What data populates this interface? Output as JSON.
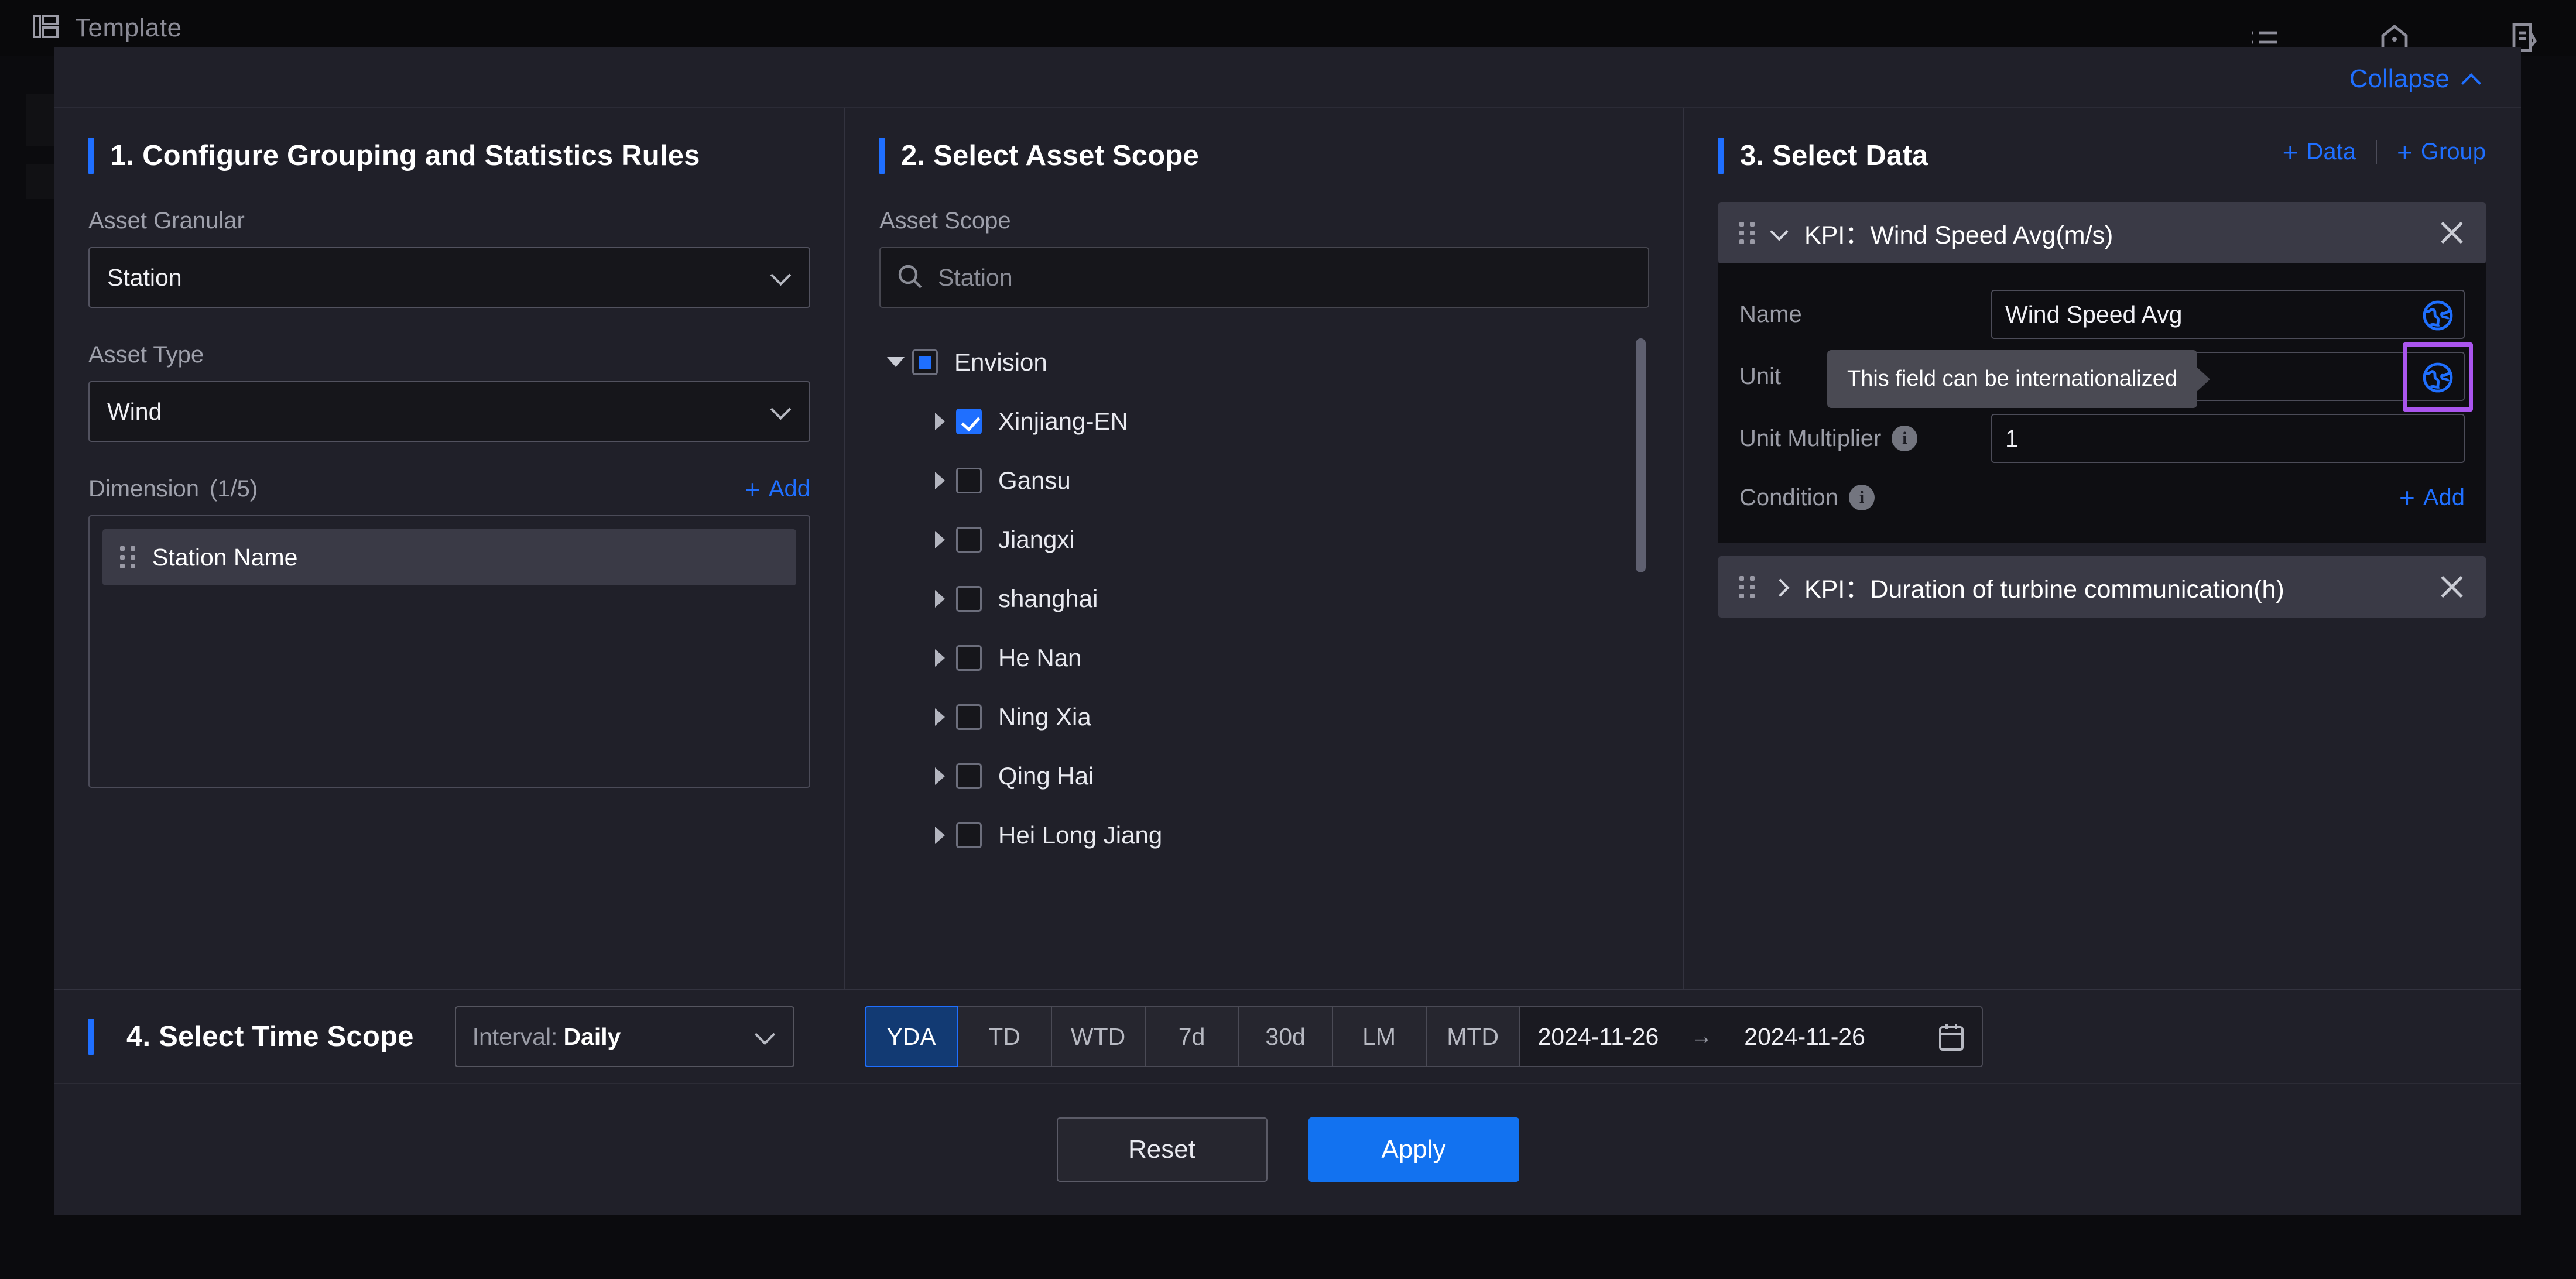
{
  "app": {
    "title": "Template",
    "topbar_icons": [
      "list-icon",
      "home-icon",
      "document-edit-icon"
    ],
    "logo_icon": "panel-layout-icon"
  },
  "modal": {
    "collapse_label": "Collapse",
    "collapse_icon": "chevron-up-icon"
  },
  "colors": {
    "accent": "#1f6fff",
    "primary_button": "#1272f0",
    "highlight": "#aa55ee",
    "panel_bg": "#202029",
    "card_header_bg": "#3a3a46"
  },
  "col1": {
    "title": "1. Configure Grouping and Statistics Rules",
    "asset_granular_label": "Asset Granular",
    "asset_granular_value": "Station",
    "asset_type_label": "Asset Type",
    "asset_type_value": "Wind",
    "dimension_label": "Dimension",
    "dimension_count": "(1/5)",
    "dimension_add_label": "Add",
    "dimension_items": [
      {
        "label": "Station Name"
      }
    ]
  },
  "col2": {
    "title": "2. Select Asset Scope",
    "asset_scope_label": "Asset Scope",
    "search_placeholder": "Station",
    "search_value": "",
    "tree": [
      {
        "label": "Envision",
        "level": 1,
        "expander": "down",
        "check": "indeterminate"
      },
      {
        "label": "Xinjiang-EN",
        "level": 2,
        "expander": "right",
        "check": "checked"
      },
      {
        "label": "Gansu",
        "level": 2,
        "expander": "right",
        "check": "unchecked"
      },
      {
        "label": "Jiangxi",
        "level": 2,
        "expander": "right",
        "check": "unchecked"
      },
      {
        "label": "shanghai",
        "level": 2,
        "expander": "right",
        "check": "unchecked"
      },
      {
        "label": "He Nan",
        "level": 2,
        "expander": "right",
        "check": "unchecked"
      },
      {
        "label": "Ning Xia",
        "level": 2,
        "expander": "right",
        "check": "unchecked"
      },
      {
        "label": "Qing Hai",
        "level": 2,
        "expander": "right",
        "check": "unchecked"
      },
      {
        "label": "Hei Long Jiang",
        "level": 2,
        "expander": "right",
        "check": "unchecked"
      }
    ]
  },
  "col3": {
    "title": "3. Select Data",
    "add_data_label": "Data",
    "add_group_label": "Group",
    "kpi1": {
      "header_prefix": "KPI：",
      "header_value": "Wind Speed Avg(m/s)",
      "expanded": true,
      "name_label": "Name",
      "name_value": "Wind Speed Avg",
      "unit_label": "Unit",
      "unit_value": "",
      "unit_multiplier_label": "Unit Multiplier",
      "unit_multiplier_value": "1",
      "condition_label": "Condition",
      "condition_add_label": "Add"
    },
    "kpi2": {
      "header_prefix": "KPI：",
      "header_value": "Duration of turbine communication(h)",
      "expanded": false
    },
    "tooltip_text": "This field can be internationalized"
  },
  "col4": {
    "title": "4. Select Time Scope",
    "interval_prefix": "Interval:",
    "interval_value": "Daily",
    "segments": [
      {
        "label": "YDA",
        "active": true
      },
      {
        "label": "TD",
        "active": false
      },
      {
        "label": "WTD",
        "active": false
      },
      {
        "label": "7d",
        "active": false
      },
      {
        "label": "30d",
        "active": false
      },
      {
        "label": "LM",
        "active": false
      },
      {
        "label": "MTD",
        "active": false
      }
    ],
    "date_start": "2024-11-26",
    "date_arrow": "→",
    "date_end": "2024-11-26"
  },
  "footer": {
    "reset_label": "Reset",
    "apply_label": "Apply"
  }
}
